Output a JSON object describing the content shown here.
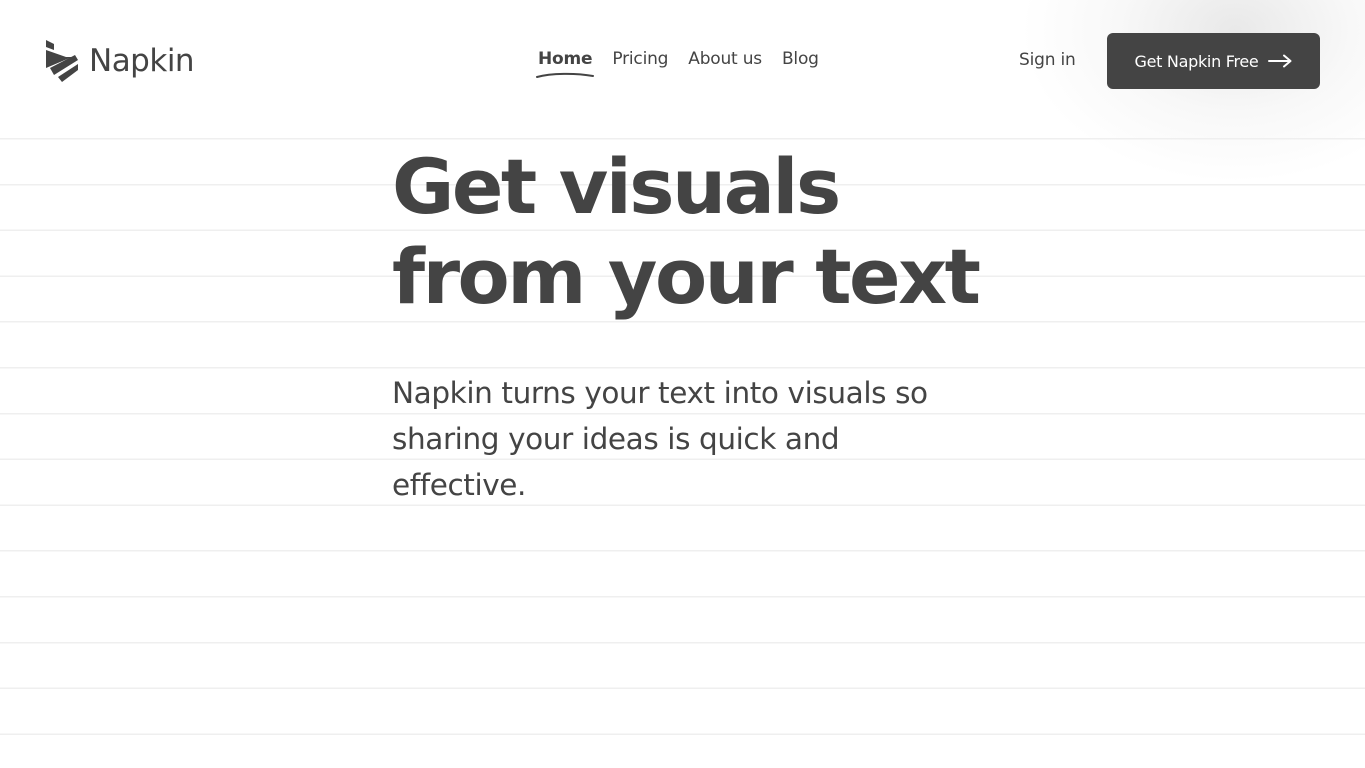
{
  "brand": {
    "name": "Napkin",
    "logo_icon": "napkin-stripes-icon"
  },
  "nav": {
    "items": [
      {
        "label": "Home",
        "active": true
      },
      {
        "label": "Pricing",
        "active": false
      },
      {
        "label": "About us",
        "active": false
      },
      {
        "label": "Blog",
        "active": false
      }
    ]
  },
  "header": {
    "signin_label": "Sign in",
    "cta_label": "Get Napkin Free",
    "cta_icon": "arrow-right-icon"
  },
  "hero": {
    "title_line1": "Get visuals",
    "title_line2": "from your text",
    "subtitle": "Napkin turns your text into visuals so sharing your ideas is quick and effective."
  },
  "colors": {
    "text": "#444444",
    "button_bg": "#444444",
    "button_text": "#ffffff",
    "ruled_line": "#efefef",
    "background": "#ffffff"
  }
}
